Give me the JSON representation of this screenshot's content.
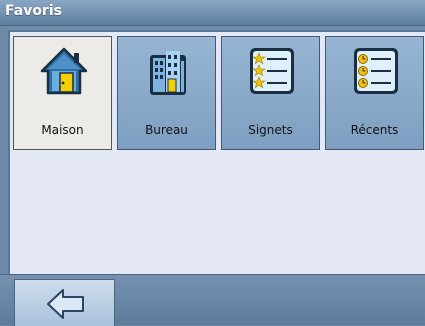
{
  "window": {
    "title": "Favoris"
  },
  "tiles": [
    {
      "label": "Maison",
      "icon": "house-icon",
      "selected": true
    },
    {
      "label": "Bureau",
      "icon": "office-building-icon",
      "selected": false
    },
    {
      "label": "Signets",
      "icon": "bookmarks-list-icon",
      "selected": false
    },
    {
      "label": "Récents",
      "icon": "recent-list-icon",
      "selected": false
    }
  ],
  "bottom": {
    "back_icon": "back-arrow-icon"
  },
  "colors": {
    "title_bar": "#6f8cad",
    "panel_bg": "#e4e8f4",
    "tile_bg": "#8fadcc",
    "tile_selected_bg": "#ecebe8",
    "icon_yellow": "#f2c400"
  }
}
